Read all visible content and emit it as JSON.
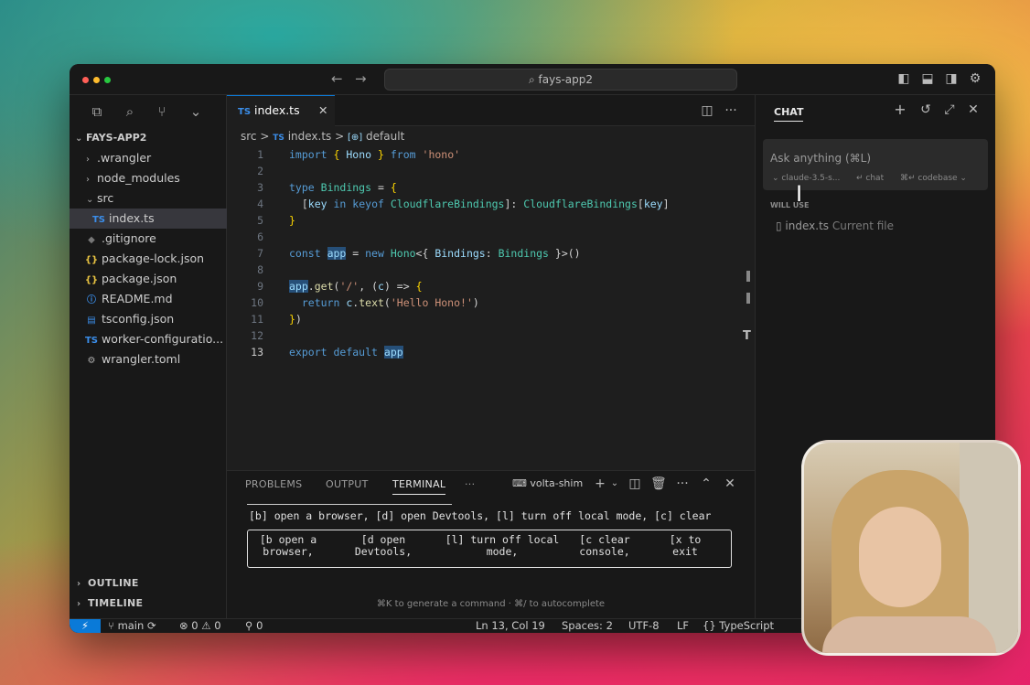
{
  "window": {
    "search_text": "fays-app2"
  },
  "sidebar": {
    "project": "FAYS-APP2",
    "items": [
      {
        "label": ".wrangler",
        "kind": "folder"
      },
      {
        "label": "node_modules",
        "kind": "folder"
      },
      {
        "label": "src",
        "kind": "folder-open"
      },
      {
        "label": "index.ts",
        "kind": "ts",
        "icon_text": "TS"
      },
      {
        "label": ".gitignore",
        "kind": "git",
        "icon_text": "◆"
      },
      {
        "label": "package-lock.json",
        "kind": "json",
        "icon_text": "{}"
      },
      {
        "label": "package.json",
        "kind": "json",
        "icon_text": "{}"
      },
      {
        "label": "README.md",
        "kind": "info",
        "icon_text": "ⓘ"
      },
      {
        "label": "tsconfig.json",
        "kind": "tsconfig",
        "icon_text": "▤"
      },
      {
        "label": "worker-configuratio...",
        "kind": "ts",
        "icon_text": "TS"
      },
      {
        "label": "wrangler.toml",
        "kind": "gear",
        "icon_text": "⚙"
      }
    ],
    "outline": "OUTLINE",
    "timeline": "TIMELINE"
  },
  "editor": {
    "tab": {
      "icon": "TS",
      "name": "index.ts",
      "close": "✕"
    },
    "breadcrumb": {
      "folder": "src",
      "sep": ">",
      "file_icon": "TS",
      "file": "index.ts",
      "symbol_icon": "[⊕]",
      "symbol": "default"
    },
    "line_numbers": [
      "1",
      "2",
      "3",
      "4",
      "5",
      "6",
      "7",
      "8",
      "9",
      "10",
      "11",
      "12",
      "13"
    ]
  },
  "terminal": {
    "tabs": [
      "PROBLEMS",
      "OUTPUT",
      "TERMINAL",
      "···"
    ],
    "shell_name": "volta-shim",
    "line1": "[b] open a browser, [d] open Devtools, [l] turn off local mode, [c] clear",
    "box": [
      {
        "l1": "[b open a",
        "l2": "browser,"
      },
      {
        "l1": "[d open",
        "l2": "Devtools,"
      },
      {
        "l1": "[l] turn off local",
        "l2": "mode,"
      },
      {
        "l1": "[c clear",
        "l2": "console,"
      },
      {
        "l1": "[x to",
        "l2": "exit"
      }
    ],
    "hint": "⌘K to generate a command · ⌘/ to autocomplete"
  },
  "chat": {
    "title": "CHAT",
    "placeholder": "Ask anything (⌘L)",
    "model": "claude-3.5-s...",
    "chat_label": "↵ chat",
    "codebase_label": "⌘↵ codebase",
    "will_use": "WILL USE",
    "context_file": "index.ts",
    "context_note": "Current file"
  },
  "status": {
    "branch": "main",
    "errors": "0",
    "warnings": "0",
    "ports": "0",
    "position": "Ln 13, Col 19",
    "spaces": "Spaces: 2",
    "encoding": "UTF-8",
    "eol": "LF",
    "language": "TypeScript"
  },
  "colors": {
    "accent": "#0a7ad8",
    "bg": "#1e1e1e",
    "panel": "#181818"
  }
}
